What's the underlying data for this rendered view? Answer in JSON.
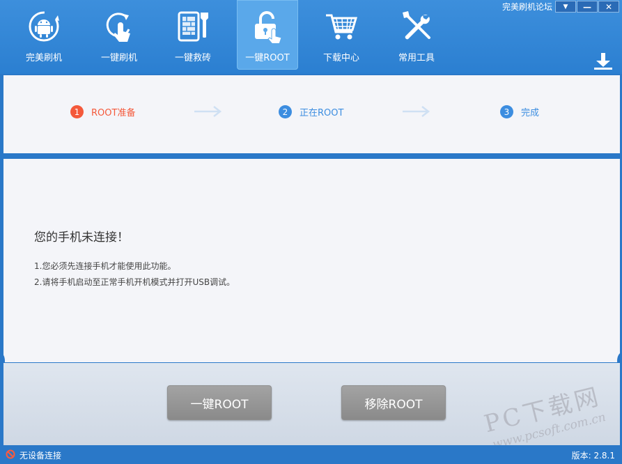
{
  "window": {
    "forum_link": "完美刷机论坛",
    "controls": {
      "dropdown": "▼",
      "minimize": "—",
      "close": "✕"
    }
  },
  "nav": {
    "items": [
      {
        "label": "完美刷机",
        "icon": "android-refresh-icon"
      },
      {
        "label": "一键刷机",
        "icon": "touch-refresh-icon"
      },
      {
        "label": "一键救砖",
        "icon": "phone-repair-icon"
      },
      {
        "label": "一键ROOT",
        "icon": "unlock-icon",
        "active": true
      },
      {
        "label": "下载中心",
        "icon": "shopping-cart-icon"
      },
      {
        "label": "常用工具",
        "icon": "tools-icon"
      }
    ],
    "download_icon": "download-icon"
  },
  "steps": [
    {
      "num": "1",
      "label": "ROOT准备",
      "state": "current"
    },
    {
      "num": "2",
      "label": "正在ROOT",
      "state": "pending"
    },
    {
      "num": "3",
      "label": "完成",
      "state": "pending"
    }
  ],
  "message": {
    "title": "您的手机未连接！",
    "line1": "1.您必须先连接手机才能使用此功能。",
    "line2": "2.请将手机启动至正常手机开机模式并打开USB调试。"
  },
  "actions": {
    "root_label": "一键ROOT",
    "unroot_label": "移除ROOT"
  },
  "watermark": {
    "big": "PC下载网",
    "small": "www.pcsoft.com.cn"
  },
  "status": {
    "text": "无设备连接",
    "version": "版本: 2.8.1"
  },
  "colors": {
    "primary": "#2a78c8",
    "step_current": "#f4593b",
    "step_pending": "#3c8de0",
    "button_gray": "#9a9a9a"
  }
}
